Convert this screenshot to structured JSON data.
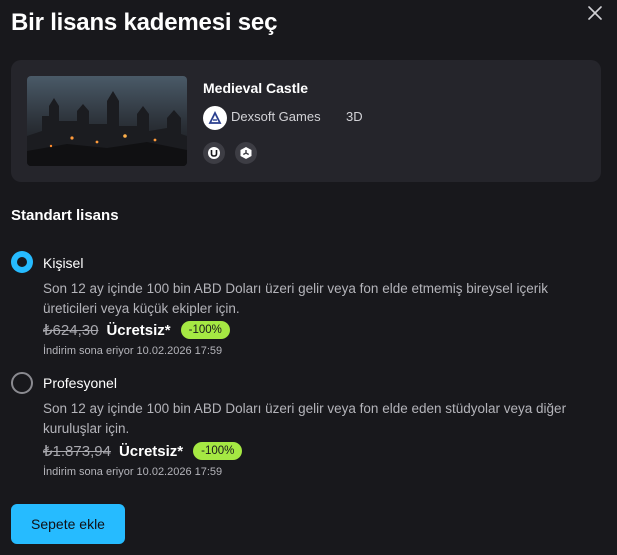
{
  "modal": {
    "title": "Bir lisans kademesi seç"
  },
  "asset": {
    "name": "Medieval Castle",
    "seller": "Dexsoft Games",
    "type": "3D",
    "engines": [
      "unreal-engine-icon",
      "unity-icon"
    ]
  },
  "license_section": {
    "title": "Standart lisans"
  },
  "options": [
    {
      "name": "Kişisel",
      "selected": true,
      "description": "Son 12 ay içinde 100 bin ABD Doları üzeri gelir veya fon elde etmemiş bireysel içerik üreticileri veya küçük ekipler için.",
      "old_price": "₺624,30",
      "price": "Ücretsiz*",
      "discount": "-100%",
      "ends": "İndirim sona eriyor 10.02.2026 17:59"
    },
    {
      "name": "Profesyonel",
      "selected": false,
      "description": "Son 12 ay içinde 100 bin ABD Doları üzeri gelir veya fon elde eden stüdyolar veya diğer kuruluşlar için.",
      "old_price": "₺1.873,94",
      "price": "Ücretsiz*",
      "discount": "-100%",
      "ends": "İndirim sona eriyor 10.02.2026 17:59"
    }
  ],
  "actions": {
    "add_to_cart": "Sepete ekle"
  },
  "colors": {
    "accent": "#26bbff",
    "discount_badge": "#a5e843",
    "background": "#18181c",
    "card": "#25252b"
  }
}
